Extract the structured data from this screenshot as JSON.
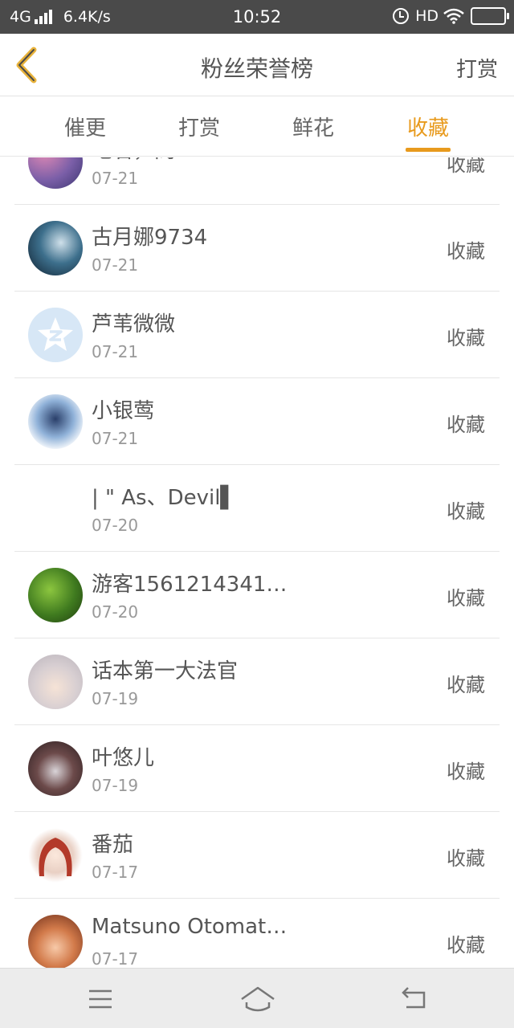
{
  "status_bar": {
    "network": "4G",
    "speed": "6.4K/s",
    "time": "10:52",
    "hd": "HD",
    "icons": [
      "signal-icon",
      "alarm-icon",
      "wifi-icon",
      "battery-icon"
    ]
  },
  "header": {
    "back_icon": "chevron-left-icon",
    "title": "粉丝荣誉榜",
    "right_action": "打赏"
  },
  "tabs": [
    {
      "label": "催更",
      "active": false
    },
    {
      "label": "打赏",
      "active": false
    },
    {
      "label": "鲜花",
      "active": false
    },
    {
      "label": "收藏",
      "active": true
    }
  ],
  "list": [
    {
      "name": "地名，阁",
      "date": "07-21",
      "action": "收藏"
    },
    {
      "name": "古月娜9734",
      "date": "07-21",
      "action": "收藏"
    },
    {
      "name": "芦苇微微",
      "date": "07-21",
      "action": "收藏"
    },
    {
      "name": "小银莺",
      "date": "07-21",
      "action": "收藏"
    },
    {
      "name": "| \" As、Devil▌",
      "date": "07-20",
      "action": "收藏"
    },
    {
      "name": "游客1561214341…",
      "date": "07-20",
      "action": "收藏"
    },
    {
      "name": "话本第一大法官",
      "date": "07-19",
      "action": "收藏"
    },
    {
      "name": "叶悠儿",
      "date": "07-19",
      "action": "收藏"
    },
    {
      "name": "番茄",
      "date": "07-17",
      "action": "收藏"
    },
    {
      "name": "Matsuno Otomat…",
      "date": "07-17",
      "action": "收藏"
    }
  ],
  "navbar": {
    "icons": [
      "menu-icon",
      "home-icon",
      "back-icon"
    ]
  },
  "colors": {
    "accent": "#e89a1d",
    "status_bar": "#4a4a4a",
    "text": "#555555",
    "subtext": "#999999"
  }
}
